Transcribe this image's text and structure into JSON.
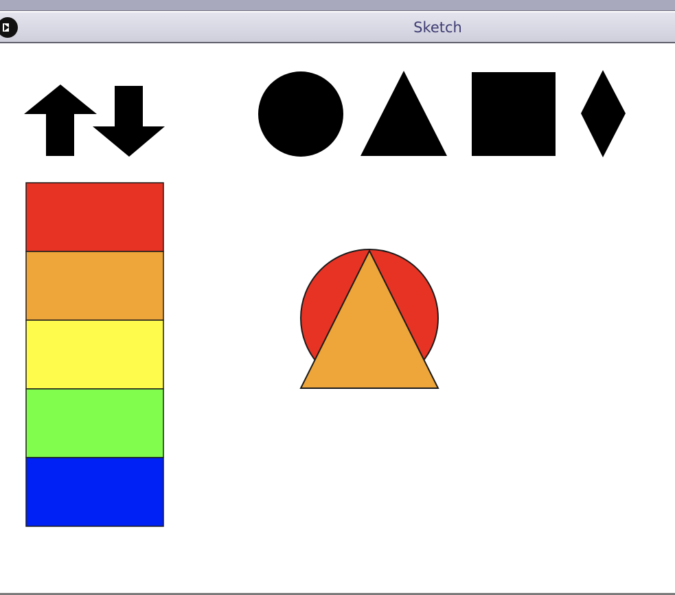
{
  "window": {
    "title": "Sketch"
  },
  "toolbar": {
    "arrows": [
      "arrow-up-icon",
      "arrow-down-icon"
    ],
    "shapes": [
      "circle-icon",
      "triangle-icon",
      "square-icon",
      "diamond-icon"
    ]
  },
  "palette": {
    "colors": [
      "#e63324",
      "#eea53a",
      "#fffb4d",
      "#80fd4d",
      "#0021f6"
    ]
  },
  "drawing": {
    "circle_fill": "#e63324",
    "triangle_fill": "#eea53a",
    "stroke": "#1a1a1a"
  }
}
